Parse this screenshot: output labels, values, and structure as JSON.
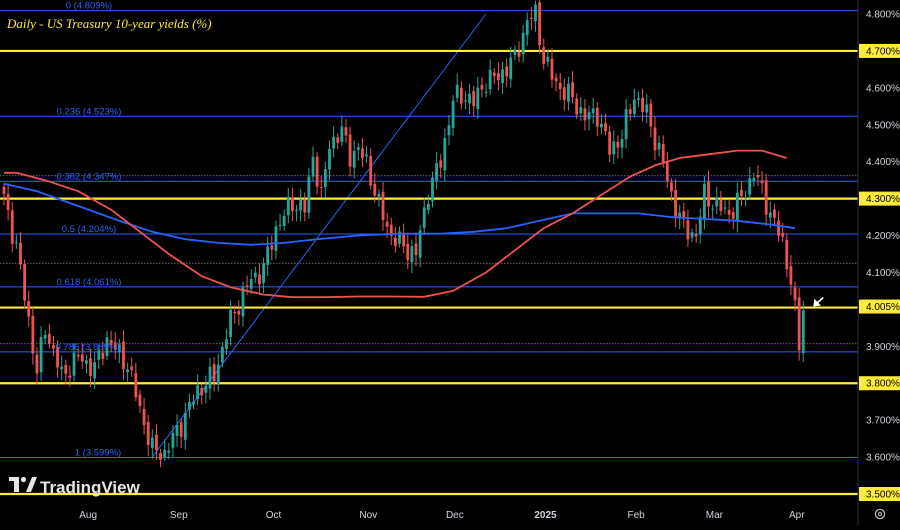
{
  "chart_data": {
    "type": "candlestick",
    "title": "Daily - US Treasury 10-year yields (%)",
    "watermark": "TradingView",
    "colors": {
      "background": "#000000",
      "up": "#26a69a",
      "down": "#ef5350",
      "fib": "#2962ff",
      "fib_label": "#2962ff",
      "trendline": "#2962ff",
      "hline": "#ffeb3b",
      "ma_fast": "#ef5350",
      "ma_slow": "#2962ff",
      "axis_text": "#d1d4dc",
      "price_box": "#ffeb3b",
      "price_box_text": "#000000"
    },
    "y_axis": {
      "min": 3.48,
      "max": 4.82,
      "ticks": [
        "4.800%",
        "4.700%",
        "4.600%",
        "4.500%",
        "4.400%",
        "4.300%",
        "4.200%",
        "4.100%",
        "4.000%",
        "3.900%",
        "3.800%",
        "3.700%",
        "3.600%",
        "3.500%"
      ],
      "tick_values": [
        4.8,
        4.7,
        4.6,
        4.5,
        4.4,
        4.3,
        4.2,
        4.1,
        4.0,
        3.9,
        3.8,
        3.7,
        3.6,
        3.5
      ],
      "boxed_ticks": [
        "4.700%",
        "4.300%",
        "3.800%",
        "3.500%"
      ],
      "boxed_values": [
        4.7,
        4.3,
        3.8,
        3.5
      ]
    },
    "last_price": {
      "label": "4.005%",
      "value": 4.005
    },
    "x_axis": {
      "labels": [
        "Aug",
        "Sep",
        "Oct",
        "Nov",
        "Dec",
        "2025",
        "Feb",
        "Mar",
        "Apr"
      ],
      "label_index": [
        18,
        40,
        63,
        86,
        107,
        129,
        151,
        170,
        190
      ]
    },
    "fib_levels": [
      {
        "label": "0 (4.809%)",
        "value": 4.809
      },
      {
        "label": "0.236 (4.523%)",
        "value": 4.523
      },
      {
        "label": "0.382 (4.347%)",
        "value": 4.347
      },
      {
        "label": "0.5 (4.204%)",
        "value": 4.204
      },
      {
        "label": "0.618 (4.061%)",
        "value": 4.061
      },
      {
        "label": "0.786 (3.885%)",
        "value": 3.885
      },
      {
        "label": "1 (3.599%)",
        "value": 3.599
      }
    ],
    "extra_lines": [
      4.362,
      4.125,
      3.907
    ],
    "horizontal_levels": [
      4.7,
      4.3,
      4.005,
      3.8,
      3.5
    ],
    "trendline": {
      "from": [
        36,
        3.6
      ],
      "to": [
        117,
        4.8
      ]
    },
    "key_points": [
      [
        0,
        4.3
      ],
      [
        3,
        4.17
      ],
      [
        6,
        3.97
      ],
      [
        8,
        3.83
      ],
      [
        10,
        3.95
      ],
      [
        14,
        3.82
      ],
      [
        18,
        3.87
      ],
      [
        22,
        3.84
      ],
      [
        25,
        3.92
      ],
      [
        30,
        3.85
      ],
      [
        33,
        3.73
      ],
      [
        36,
        3.62
      ],
      [
        39,
        3.61
      ],
      [
        43,
        3.69
      ],
      [
        47,
        3.78
      ],
      [
        51,
        3.82
      ],
      [
        55,
        3.97
      ],
      [
        58,
        4.04
      ],
      [
        60,
        4.08
      ],
      [
        63,
        4.11
      ],
      [
        66,
        4.22
      ],
      [
        70,
        4.29
      ],
      [
        73,
        4.27
      ],
      [
        75,
        4.42
      ],
      [
        77,
        4.3
      ],
      [
        79,
        4.45
      ],
      [
        82,
        4.48
      ],
      [
        84,
        4.42
      ],
      [
        86,
        4.43
      ],
      [
        88,
        4.4
      ],
      [
        91,
        4.28
      ],
      [
        94,
        4.2
      ],
      [
        97,
        4.17
      ],
      [
        100,
        4.15
      ],
      [
        103,
        4.32
      ],
      [
        106,
        4.4
      ],
      [
        109,
        4.57
      ],
      [
        112,
        4.58
      ],
      [
        114,
        4.56
      ],
      [
        117,
        4.62
      ],
      [
        120,
        4.63
      ],
      [
        124,
        4.68
      ],
      [
        127,
        4.78
      ],
      [
        129,
        4.8
      ],
      [
        131,
        4.68
      ],
      [
        133,
        4.63
      ],
      [
        135,
        4.6
      ],
      [
        138,
        4.57
      ],
      [
        141,
        4.52
      ],
      [
        144,
        4.53
      ],
      [
        147,
        4.43
      ],
      [
        150,
        4.47
      ],
      [
        153,
        4.58
      ],
      [
        156,
        4.53
      ],
      [
        159,
        4.43
      ],
      [
        162,
        4.31
      ],
      [
        165,
        4.22
      ],
      [
        168,
        4.2
      ],
      [
        170,
        4.31
      ],
      [
        173,
        4.28
      ],
      [
        176,
        4.26
      ],
      [
        179,
        4.3
      ],
      [
        182,
        4.37
      ],
      [
        184,
        4.32
      ],
      [
        186,
        4.26
      ],
      [
        189,
        4.18
      ],
      [
        191,
        4.08
      ],
      [
        193,
        3.9
      ],
      [
        194,
        4.005
      ]
    ],
    "ma_fast": [
      [
        0,
        4.37
      ],
      [
        3,
        4.37
      ],
      [
        10,
        4.35
      ],
      [
        18,
        4.32
      ],
      [
        26,
        4.27
      ],
      [
        33,
        4.21
      ],
      [
        40,
        4.15
      ],
      [
        48,
        4.09
      ],
      [
        55,
        4.06
      ],
      [
        63,
        4.04
      ],
      [
        70,
        4.033
      ],
      [
        78,
        4.033
      ],
      [
        86,
        4.035
      ],
      [
        94,
        4.035
      ],
      [
        102,
        4.034
      ],
      [
        109,
        4.05
      ],
      [
        117,
        4.1
      ],
      [
        124,
        4.16
      ],
      [
        131,
        4.22
      ],
      [
        138,
        4.26
      ],
      [
        145,
        4.31
      ],
      [
        152,
        4.36
      ],
      [
        158,
        4.39
      ],
      [
        164,
        4.41
      ],
      [
        171,
        4.42
      ],
      [
        178,
        4.43
      ],
      [
        184,
        4.43
      ],
      [
        190,
        4.41
      ]
    ],
    "ma_slow": [
      [
        0,
        4.34
      ],
      [
        8,
        4.32
      ],
      [
        18,
        4.28
      ],
      [
        28,
        4.24
      ],
      [
        36,
        4.21
      ],
      [
        44,
        4.19
      ],
      [
        52,
        4.18
      ],
      [
        60,
        4.175
      ],
      [
        68,
        4.18
      ],
      [
        76,
        4.19
      ],
      [
        86,
        4.2
      ],
      [
        96,
        4.205
      ],
      [
        106,
        4.205
      ],
      [
        114,
        4.21
      ],
      [
        122,
        4.22
      ],
      [
        130,
        4.24
      ],
      [
        138,
        4.26
      ],
      [
        146,
        4.26
      ],
      [
        154,
        4.26
      ],
      [
        162,
        4.25
      ],
      [
        170,
        4.245
      ],
      [
        178,
        4.24
      ],
      [
        186,
        4.23
      ],
      [
        192,
        4.22
      ]
    ]
  }
}
